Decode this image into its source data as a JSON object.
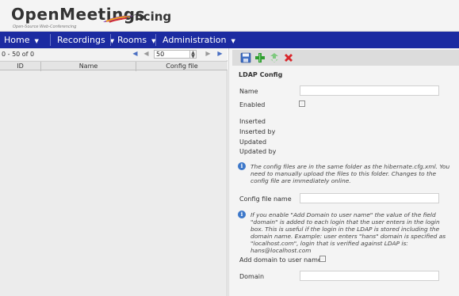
{
  "header": {
    "logo_title": "OpenMeetings",
    "logo_subtitle": "Open-Source Web-Conferencing",
    "conference_name": "ncing"
  },
  "menu": {
    "items": [
      {
        "label": "Home"
      },
      {
        "label": "Recordings"
      },
      {
        "label": "Rooms"
      },
      {
        "label": "Administration"
      }
    ]
  },
  "pager": {
    "count_text": "0 - 50 of 0",
    "page_size": "50"
  },
  "grid": {
    "columns": [
      "ID",
      "Name",
      "Config file"
    ]
  },
  "form": {
    "title": "LDAP Config",
    "name_label": "Name",
    "enabled_label": "Enabled",
    "inserted_label": "Inserted",
    "inserted_by_label": "Inserted by",
    "updated_label": "Updated",
    "updated_by_label": "Updated by",
    "info_config_files": "The config files are in the same folder as the hibernate.cfg.xml. You need to manually upload the files to this folder. Changes to the config file are immediately online.",
    "config_file_label": "Config file name",
    "info_add_domain": "If you enable \"Add Domain to user name\" the value of the field \"domain\" is added to each login that the user enters in the login box. This is useful if the login in the LDAP is stored including the domain name. Example: user enters \"hans\" domain is specified as \"localhost.com\", login that is verified against LDAP is: hans@localhost.com",
    "add_domain_label": "Add domain to user name",
    "domain_label": "Domain"
  },
  "icons": {
    "save": "floppy-disk-icon",
    "add": "add-plus-icon",
    "refresh": "refresh-icon",
    "delete": "delete-x-icon"
  },
  "colors": {
    "menubar": "#1c2ba1",
    "info": "#3c77c9",
    "delete": "#d9262b",
    "add": "#2f9e2f"
  }
}
